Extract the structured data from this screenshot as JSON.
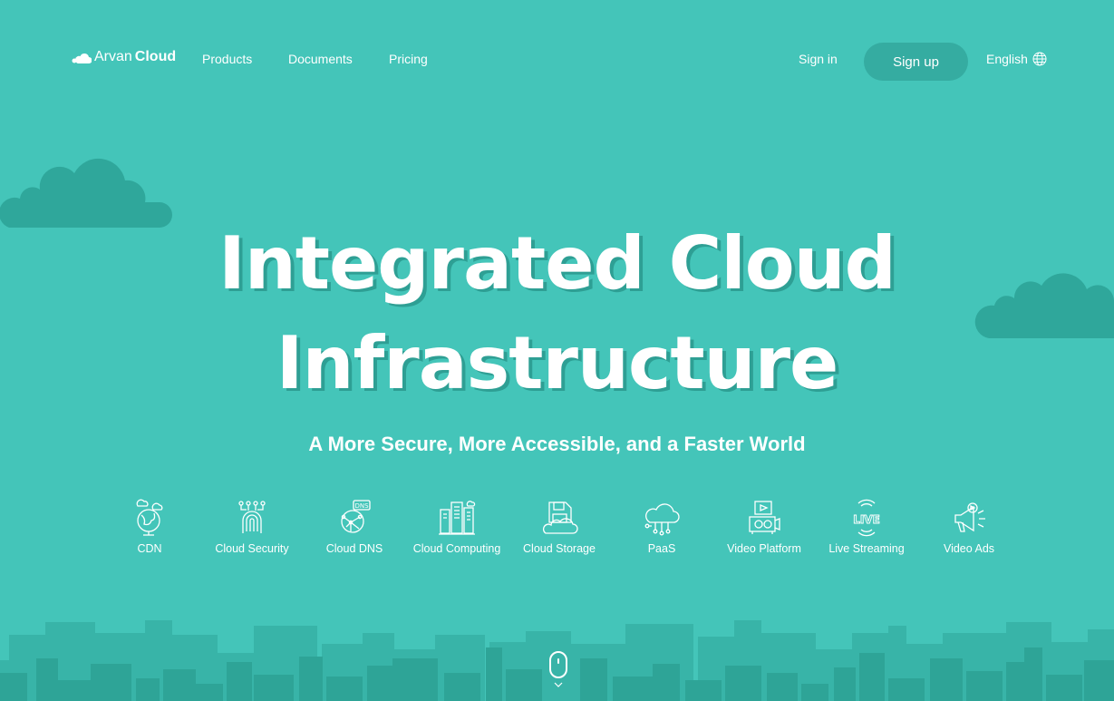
{
  "nav": {
    "logo": {
      "part1": "Arvan",
      "part2": "Cloud",
      "icon": "cloud-logo-icon"
    },
    "links": [
      {
        "label": "Products"
      },
      {
        "label": "Documents"
      },
      {
        "label": "Pricing"
      }
    ],
    "sign_in": "Sign in",
    "sign_up": "Sign up",
    "language": "English",
    "language_icon": "globe-icon"
  },
  "hero": {
    "title_line1": "Integrated Cloud",
    "title_line2": "Infrastructure",
    "subtitle": "A More Secure, More Accessible, and a Faster World"
  },
  "products": [
    {
      "label": "CDN",
      "icon": "cdn-globe-icon"
    },
    {
      "label": "Cloud Security",
      "icon": "fingerprint-icon"
    },
    {
      "label": "Cloud DNS",
      "icon": "dns-globe-icon"
    },
    {
      "label": "Cloud Computing",
      "icon": "server-cloud-icon"
    },
    {
      "label": "Cloud Storage",
      "icon": "floppy-cloud-icon"
    },
    {
      "label": "PaaS",
      "icon": "cloud-network-icon"
    },
    {
      "label": "Video Platform",
      "icon": "video-camera-icon"
    },
    {
      "label": "Live Streaming",
      "icon": "live-broadcast-icon"
    },
    {
      "label": "Video Ads",
      "icon": "megaphone-icon"
    }
  ],
  "colors": {
    "background": "#44c5b9",
    "accent_dark": "#2fa79b",
    "button": "#35aca1",
    "text": "#ffffff"
  }
}
